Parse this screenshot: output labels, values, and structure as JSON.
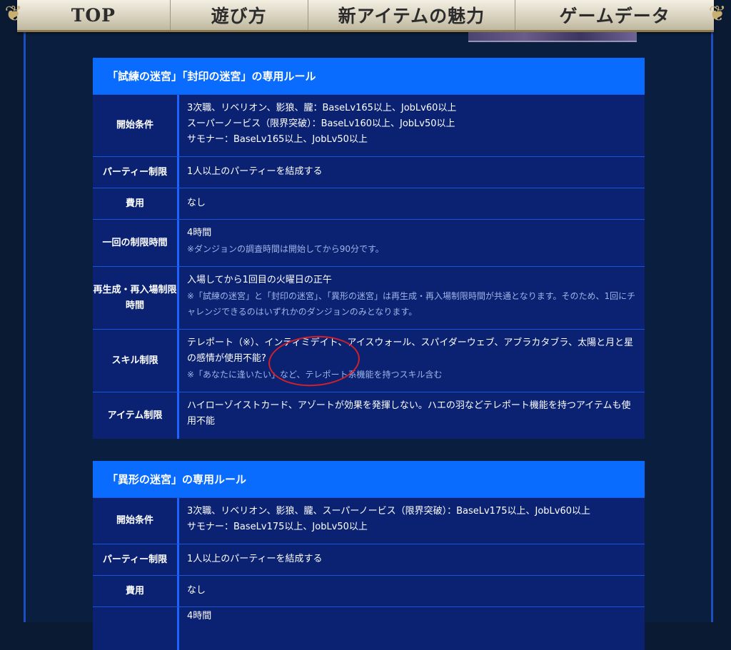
{
  "nav": {
    "items": [
      "TOP",
      "遊び方",
      "新アイテムの魅力",
      "ゲームデータ"
    ]
  },
  "section1": {
    "title": "「試練の迷宮」「封印の迷宮」の専用ルール",
    "rows": [
      {
        "label": "開始条件",
        "lines": [
          "3次職、リベリオン、影狼、朧：BaseLv165以上、JobLv60以上",
          "スーパーノービス（限界突破）：BaseLv160以上、JobLv50以上",
          "サモナー：BaseLv165以上、JobLv50以上"
        ]
      },
      {
        "label": "パーティー制限",
        "lines": [
          "1人以上のパーティーを結成する"
        ]
      },
      {
        "label": "費用",
        "lines": [
          "なし"
        ]
      },
      {
        "label": "一回の制限時間",
        "lines": [
          "4時間"
        ],
        "note": "※ダンジョンの調査時間は開始してから90分です。"
      },
      {
        "label": "再生成・再入場制限時間",
        "lines": [
          "入場してから1回目の火曜日の正午"
        ],
        "note": "※「試練の迷宮」と「封印の迷宮」、「異形の迷宮」は再生成・再入場制限時間が共通となります。そのため、1回にチャレンジできるのはいずれかのダンジョンのみとなります。"
      },
      {
        "label": "スキル制限",
        "lines": [
          "テレポート（※）、インティミデイト、アイスウォール、スパイダーウェブ、アブラカタブラ、太陽と月と星の感情が使用不能?"
        ],
        "note": "※「あなたに逢いたい」など、テレポート系機能を持つスキル含む"
      },
      {
        "label": "アイテム制限",
        "lines": [
          "ハイローゾイストカード、アゾートが効果を発揮しない。ハエの羽などテレポート機能を持つアイテムも使用不能"
        ]
      }
    ]
  },
  "section2": {
    "title": "「異形の迷宮」の専用ルール",
    "rows": [
      {
        "label": "開始条件",
        "lines": [
          "3次職、リベリオン、影狼、朧、スーパーノービス（限界突破）：BaseLv175以上、JobLv60以上",
          "サモナー：BaseLv175以上、JobLv50以上"
        ]
      },
      {
        "label": "パーティー制限",
        "lines": [
          "1人以上のパーティーを結成する"
        ]
      },
      {
        "label": "費用",
        "lines": [
          "なし"
        ]
      },
      {
        "label": "",
        "lines": [
          "4時間"
        ]
      }
    ]
  },
  "colors": {
    "header_blue": "#0a6cff",
    "table_bg": "#0b2273",
    "border": "#1c63ff",
    "annotation_red": "#d0202a"
  }
}
